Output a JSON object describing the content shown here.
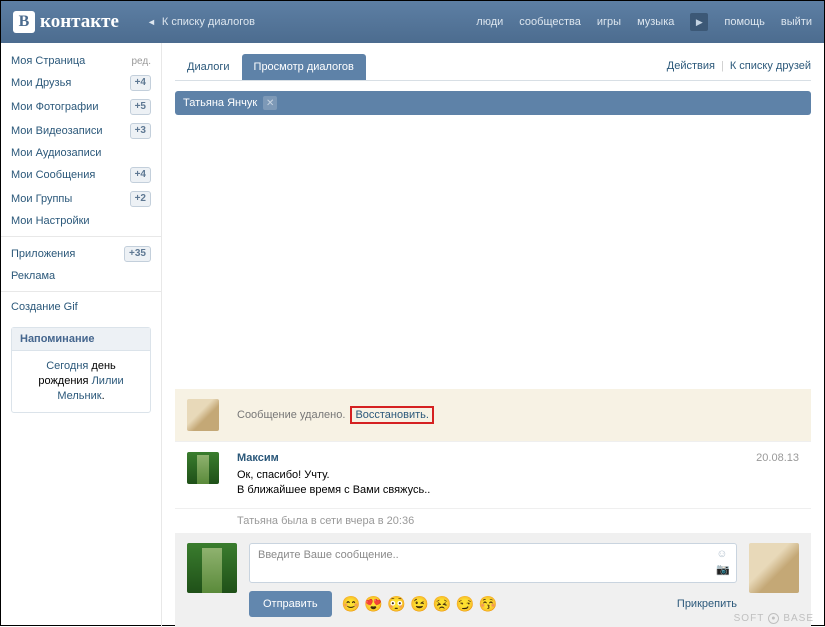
{
  "logo": "контакте",
  "logo_letter": "В",
  "back_to_dialogs": "К списку диалогов",
  "topnav": {
    "people": "люди",
    "communities": "сообщества",
    "games": "игры",
    "music": "музыка",
    "help": "помощь",
    "logout": "выйти"
  },
  "sidebar": {
    "items": [
      {
        "label": "Моя Страница",
        "badge": "ред."
      },
      {
        "label": "Мои Друзья",
        "badge": "+4"
      },
      {
        "label": "Мои Фотографии",
        "badge": "+5"
      },
      {
        "label": "Мои Видеозаписи",
        "badge": "+3"
      },
      {
        "label": "Мои Аудиозаписи",
        "badge": ""
      },
      {
        "label": "Мои Сообщения",
        "badge": "+4"
      },
      {
        "label": "Мои Группы",
        "badge": "+2"
      },
      {
        "label": "Мои Настройки",
        "badge": ""
      }
    ],
    "items2": [
      {
        "label": "Приложения",
        "badge": "+35"
      },
      {
        "label": "Реклама",
        "badge": ""
      }
    ],
    "items3": [
      {
        "label": "Создание Gif",
        "badge": ""
      }
    ]
  },
  "reminder": {
    "title": "Напоминание",
    "today": "Сегодня",
    "bday": " день рождения ",
    "name": "Лилии Мельник",
    "dot": "."
  },
  "tabs": {
    "dialogs": "Диалоги",
    "view": "Просмотр диалогов",
    "actions": "Действия",
    "friends": "К списку друзей"
  },
  "chip": {
    "name": "Татьяна Янчук"
  },
  "deleted": {
    "text": "Сообщение удалено.",
    "restore": "Восстановить."
  },
  "message": {
    "name": "Максим",
    "date": "20.08.13",
    "line1": "Ок, спасибо! Учту.",
    "line2": "В ближайшее время с Вами свяжусь.."
  },
  "last_seen": "Татьяна была в сети вчера в 20:36",
  "compose": {
    "placeholder": "Введите Ваше сообщение..",
    "send": "Отправить",
    "attach": "Прикрепить",
    "emojis": "😊 😍 😳 😉 😣 😏 😚"
  },
  "watermark": {
    "a": "SOFT",
    "b": "BASE"
  }
}
